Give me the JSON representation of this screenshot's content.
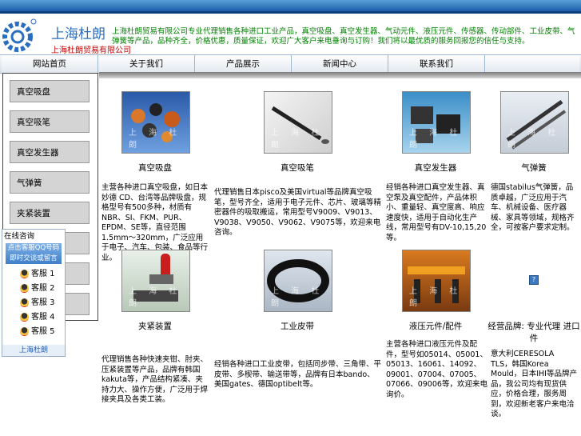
{
  "header": {
    "brand": "上海杜朗",
    "brand_sub": "上海杜朗贸易有限公司",
    "marquee": "上海杜朗贸易有限公司专业代理销售各种进口工业产品，真空吸盘、真空发生器、气动元件、液压元件、传感器、传动部件、工业皮带、气弹簧等产品，品种齐全，价格优惠，质量保证，欢迎广大客户来电垂询与订购！我们将以最优质的服务回报您的信任与支持。"
  },
  "nav": [
    "网站首页",
    "关于我们",
    "产品展示",
    "新闻中心",
    "联系我们"
  ],
  "sidebar": [
    "真空吸盘",
    "真空吸笔",
    "真空发生器",
    "气弹簧",
    "夹紧装置"
  ],
  "qq": {
    "title": "在线咨询",
    "banner1": "点击客服QQ号码",
    "banner2": "即时交谈或留言",
    "items": [
      "客服 1",
      "客服 2",
      "客服 3",
      "客服 4",
      "客服 5"
    ],
    "foot": "上海杜朗"
  },
  "watermark": "上 海 杜 朗",
  "products": [
    {
      "caption": "真空吸盘",
      "desc": "主营各种进口真空吸盘，如日本妙德 CD、台湾等品牌吸盘，规格型号有500多种，材质有NBR、SI、FKM、PUR、EPDM、SE等，直径范围1.5mm～320mm，广泛应用于电子、汽车、包装、食品等行业。"
    },
    {
      "caption": "真空吸笔",
      "desc": "代理销售日本pisco及美国virtual等品牌真空吸笔，型号齐全，适用于电子元件、芯片、玻璃等精密器件的吸取搬运，常用型号V9009、V9013、V9038、V9050、V9062、V9075等，欢迎来电咨询。"
    },
    {
      "caption": "真空发生器",
      "desc": "经销各种进口真空发生器、真空泵及真空配件，产品体积小、重量轻、真空度高、响应速度快，适用于自动化生产线，常用型号有DV-10,15,20等。"
    },
    {
      "caption": "气弹簧",
      "desc": "德国stabilus气弹簧，品质卓越，广泛应用于汽车、机械设备、医疗器械、家具等领域，规格齐全，可按客户要求定制。"
    },
    {
      "caption": "夹紧装置",
      "desc": "代理销售各种快速夹钳、肘夹、压紧装置等产品，品牌有韩国kakuta等，产品结构紧凑、夹持力大、操作方便，广泛用于焊接夹具及各类工装。"
    },
    {
      "caption": "工业皮带",
      "desc": "经销各种进口工业皮带，包括同步带、三角带、平皮带、多楔带、输送带等，品牌有日本bando、美国gates、德国optibelt等。"
    },
    {
      "caption": "液压元件/配件",
      "desc": "主营各种进口液压元件及配件，型号如05014、05001、05013、16061、14092、09001、07004、07005、07066、09006等，欢迎来电询价。"
    },
    {
      "caption": "经营品牌: 专业代理 进口件",
      "desc": "意大利CERESOLA TLS，韩国Korea Mould，日本IHI等品牌产品，我公司均有现货供应，价格合理，服务周到，欢迎新老客户来电洽谈。"
    }
  ]
}
